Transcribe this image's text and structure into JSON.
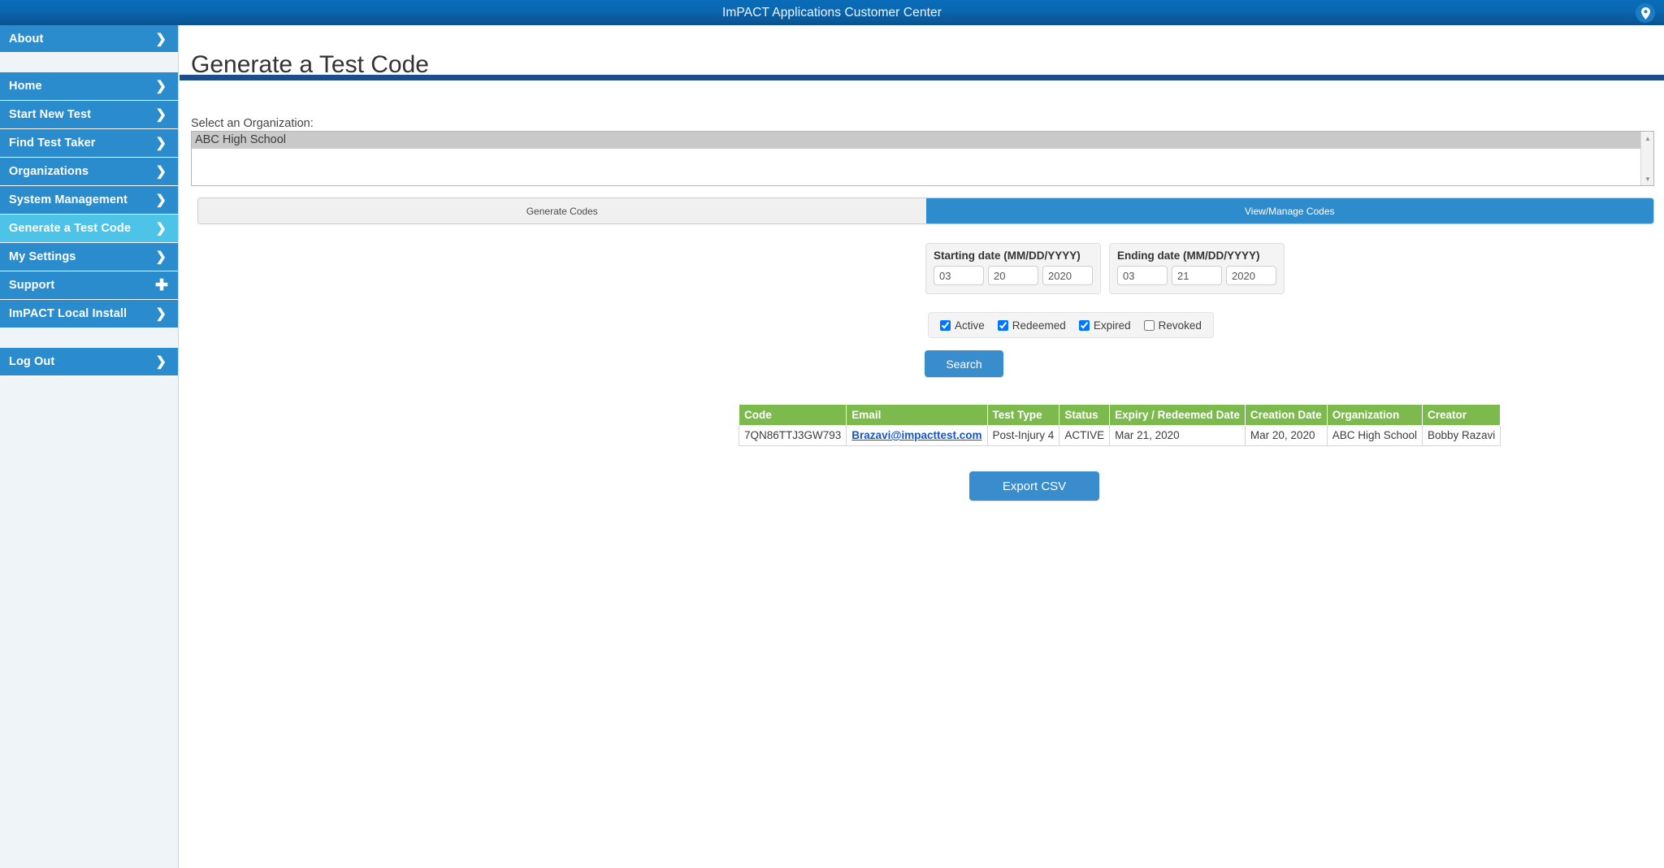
{
  "topbar": {
    "title": "ImPACT Applications Customer Center",
    "badge_icon": "location-pin-icon"
  },
  "sidebar": {
    "top_items": [
      {
        "label": "About",
        "icon": "chevron-right-icon",
        "active": false
      }
    ],
    "items": [
      {
        "label": "Home",
        "icon": "chevron-right-icon",
        "active": false
      },
      {
        "label": "Start New Test",
        "icon": "chevron-right-icon",
        "active": false
      },
      {
        "label": "Find Test Taker",
        "icon": "chevron-right-icon",
        "active": false
      },
      {
        "label": "Organizations",
        "icon": "chevron-right-icon",
        "active": false
      },
      {
        "label": "System Management",
        "icon": "chevron-right-icon",
        "active": false
      },
      {
        "label": "Generate a Test Code",
        "icon": "chevron-right-icon",
        "active": true
      },
      {
        "label": "My Settings",
        "icon": "chevron-right-icon",
        "active": false
      },
      {
        "label": "Support",
        "icon": "plus-icon",
        "active": false
      },
      {
        "label": "ImPACT Local Install",
        "icon": "chevron-right-icon",
        "active": false
      }
    ],
    "footer_items": [
      {
        "label": "Log Out",
        "icon": "chevron-right-icon",
        "active": false
      }
    ]
  },
  "main": {
    "page_title": "Generate a Test Code",
    "org_label": "Select an Organization:",
    "org_options": [
      "ABC High School"
    ],
    "org_selected": "ABC High School",
    "tabs": [
      {
        "label": "Generate Codes",
        "selected": false
      },
      {
        "label": "View/Manage Codes",
        "selected": true
      }
    ],
    "start_date": {
      "legend": "Starting date (MM/DD/YYYY)",
      "month": "03",
      "day": "20",
      "year": "2020"
    },
    "end_date": {
      "legend": "Ending date (MM/DD/YYYY)",
      "month": "03",
      "day": "21",
      "year": "2020"
    },
    "status_filters": [
      {
        "label": "Active",
        "checked": true
      },
      {
        "label": "Redeemed",
        "checked": true
      },
      {
        "label": "Expired",
        "checked": true
      },
      {
        "label": "Revoked",
        "checked": false
      }
    ],
    "search_button": "Search",
    "export_button": "Export CSV",
    "table": {
      "columns": [
        "Code",
        "Email",
        "Test Type",
        "Status",
        "Expiry / Redeemed Date",
        "Creation Date",
        "Organization",
        "Creator"
      ],
      "rows": [
        {
          "code": "7QN86TTJ3GW793",
          "email": "Brazavi@impacttest.com",
          "test_type": "Post-Injury 4",
          "status": "ACTIVE",
          "expiry_redeemed_date": "Mar 21, 2020",
          "creation_date": "Mar 20, 2020",
          "organization": "ABC High School",
          "creator": "Bobby Razavi"
        }
      ]
    }
  },
  "colors": {
    "topbar_blue": "#0a67b2",
    "nav_blue": "#2a8ccd",
    "nav_active": "#4ec3e8",
    "rule_navy": "#1a4f8b",
    "button_blue": "#3a8dcc",
    "table_header_green": "#7dba4d",
    "sidebar_bg": "#eef4f8"
  }
}
